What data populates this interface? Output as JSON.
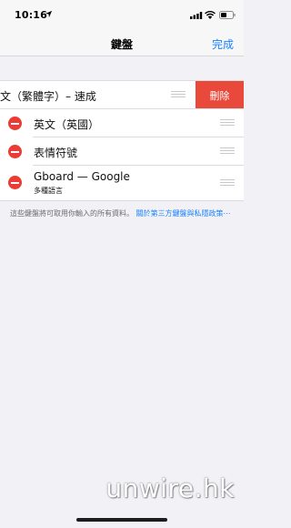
{
  "status_bar": {
    "time": "10:16"
  },
  "nav": {
    "title": "鍵盤",
    "done": "完成"
  },
  "keyboards": [
    {
      "label": "文（繁體字）– 速成",
      "swiped": true,
      "delete_label": "刪除"
    },
    {
      "label": "英文（英國）"
    },
    {
      "label": "表情符號"
    },
    {
      "label": "Gboard — Google",
      "sub": "多種語言"
    }
  ],
  "footer": {
    "text": "這些鍵盤將可取用你輸入的所有資料。",
    "link": "關於第三方鍵盤與私隱政策⋯"
  },
  "watermark": "unwire.hk",
  "colors": {
    "accent": "#1a82fb",
    "delete": "#e8493b",
    "minus": "#ec3b34"
  }
}
